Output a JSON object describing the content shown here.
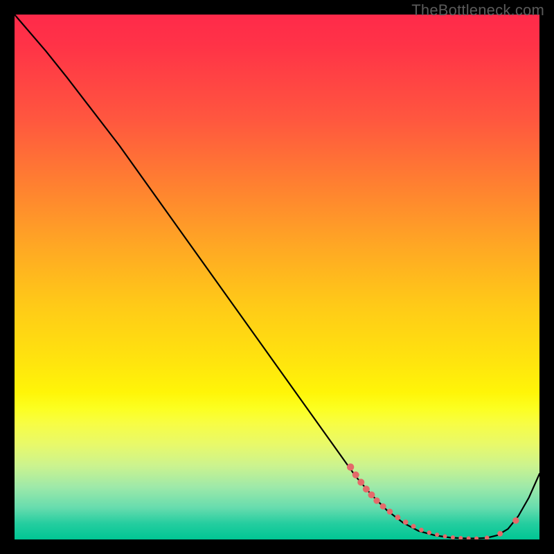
{
  "watermark": "TheBottleneck.com",
  "chart_data": {
    "type": "line",
    "title": "",
    "xlabel": "",
    "ylabel": "",
    "xlim": [
      0,
      100
    ],
    "ylim": [
      0,
      100
    ],
    "series": [
      {
        "name": "bottleneck-curve",
        "x": [
          0,
          6,
          10,
          20,
          30,
          40,
          50,
          60,
          65,
          68,
          71,
          74,
          77,
          80,
          83,
          86,
          88,
          90,
          92,
          94,
          96,
          98,
          100
        ],
        "y": [
          100,
          93,
          88,
          75,
          61,
          47,
          33,
          19,
          12,
          8.5,
          5.5,
          3.2,
          1.6,
          0.8,
          0.35,
          0.2,
          0.2,
          0.3,
          0.8,
          2.0,
          4.5,
          8.0,
          12.5
        ]
      }
    ],
    "markers": {
      "name": "highlight-dots",
      "color": "#e46a6a",
      "points_x": [
        64,
        65,
        66,
        67,
        68,
        69,
        70.2,
        71.5,
        73,
        74.5,
        76,
        77.5,
        79,
        80.5,
        82,
        83.5,
        85,
        86.5,
        88,
        90,
        92.5,
        95.5
      ],
      "points_y": [
        13.8,
        12.3,
        10.9,
        9.6,
        8.5,
        7.4,
        6.3,
        5.3,
        4.2,
        3.3,
        2.5,
        1.8,
        1.3,
        0.9,
        0.6,
        0.4,
        0.28,
        0.22,
        0.2,
        0.3,
        1.1,
        3.6
      ],
      "radius": [
        5.2,
        5.0,
        5.0,
        5.0,
        5.0,
        4.7,
        4.5,
        4.3,
        4.0,
        3.8,
        3.5,
        3.3,
        3.2,
        3.1,
        3.0,
        3.0,
        3.0,
        3.0,
        3.0,
        3.3,
        4.0,
        4.7
      ]
    },
    "grid": false,
    "legend": false
  }
}
